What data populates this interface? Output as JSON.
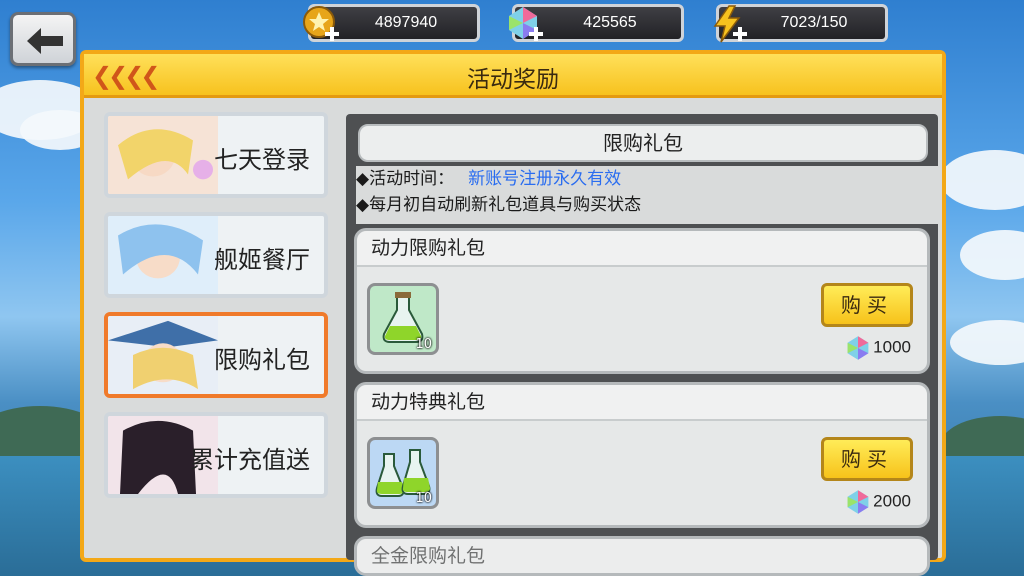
{
  "topbar": {
    "gold": "4897940",
    "gems": "425565",
    "energy": "7023/150"
  },
  "panel": {
    "title": "活动奖励"
  },
  "tabs": [
    {
      "label": "七天登录",
      "active": false
    },
    {
      "label": "舰姬餐厅",
      "active": false
    },
    {
      "label": "限购礼包",
      "active": true
    },
    {
      "label": "累计充值送",
      "active": false
    }
  ],
  "content": {
    "title": "限购礼包",
    "time_label": "◆活动时间：",
    "time_value": "新账号注册永久有效",
    "note": "◆每月初自动刷新礼包道具与购买状态",
    "packs": [
      {
        "name": "动力限购礼包",
        "item_count": "10",
        "buy_label": "购买",
        "price": "1000",
        "icon": "potion-single-icon"
      },
      {
        "name": "动力特典礼包",
        "item_count": "10",
        "buy_label": "购买",
        "price": "2000",
        "icon": "potion-double-icon"
      },
      {
        "name": "全金限购礼包"
      }
    ]
  },
  "colors": {
    "accent": "#f7c21e",
    "link": "#2a6df0",
    "frame": "#f3a817"
  }
}
